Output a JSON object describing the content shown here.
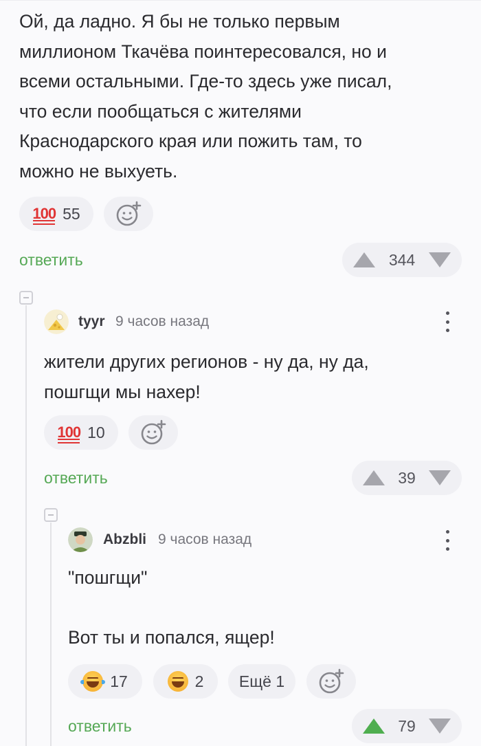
{
  "comment1": {
    "text": "Ой, да ладно. Я бы не только первым\nмиллионом Ткачёва поинтересовался, но и\nвсеми остальными. Где-то здесь уже писал,\nчто если пообщаться с жителями\nКраснодарского края или пожить там, то\nможно не выхуеть.",
    "reactions": [
      {
        "icon": "hundred-points-icon",
        "count": "55"
      }
    ],
    "reply_label": "ответить",
    "rating": "344"
  },
  "comment2": {
    "author": "tyyr",
    "time": "9 часов назад",
    "text": "жители других регионов - ну да, ну да,\nпошгщи мы нахер!",
    "reactions": [
      {
        "icon": "hundred-points-icon",
        "count": "10"
      }
    ],
    "reply_label": "ответить",
    "rating": "39"
  },
  "comment3": {
    "author": "Abzbli",
    "time": "9 часов назад",
    "text": "\"пошгщи\"\n\nВот ты и попался, ящер!",
    "reactions": [
      {
        "icon": "tears-of-joy-icon",
        "count": "17"
      },
      {
        "icon": "grinning-squinting-face-icon",
        "count": "2"
      }
    ],
    "more_reactions": "Ещё 1",
    "reply_label": "ответить",
    "rating": "79"
  },
  "colors": {
    "accent": "#55a855",
    "upvote_active": "#4fae4f",
    "background": "#fafafc"
  }
}
